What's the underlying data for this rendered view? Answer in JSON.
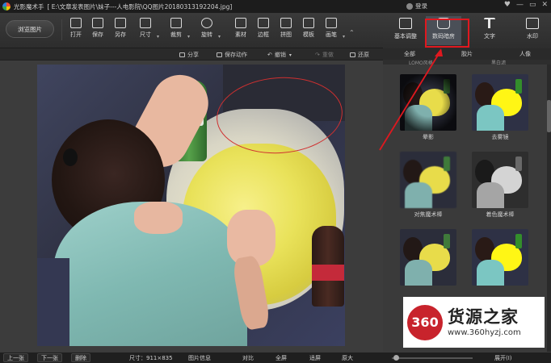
{
  "window": {
    "app_name": "光影魔术手",
    "file_path": "[ E:\\文章发表图片\\妹子---人电影院\\QQ图片20180313192204.jpg]",
    "login_label": "登录",
    "controls": [
      "♥",
      "—",
      "▭",
      "✕"
    ]
  },
  "toolbar": {
    "browse_label": "浏览图片",
    "tools": [
      {
        "label": "打开",
        "icon": "open-icon"
      },
      {
        "label": "保存",
        "icon": "save-icon"
      },
      {
        "label": "另存",
        "icon": "save-as-icon"
      },
      {
        "label": "尺寸",
        "icon": "resize-icon"
      },
      {
        "label": "裁剪",
        "icon": "crop-icon"
      },
      {
        "label": "旋转",
        "icon": "rotate-icon"
      },
      {
        "label": "素材",
        "icon": "material-icon"
      },
      {
        "label": "边框",
        "icon": "border-icon"
      },
      {
        "label": "拼图",
        "icon": "collage-icon"
      },
      {
        "label": "模板",
        "icon": "template-icon"
      },
      {
        "label": "画笔",
        "icon": "brush-icon"
      }
    ],
    "more_icon": "ellipsis-icon"
  },
  "right_tabs": [
    {
      "label": "基本调整",
      "icon": "adjust-icon"
    },
    {
      "label": "数码暗房",
      "icon": "camera-icon",
      "active": true
    },
    {
      "label": "文字",
      "icon": "text-icon"
    },
    {
      "label": "水印",
      "icon": "watermark-icon"
    }
  ],
  "actions": {
    "share": "分享",
    "save_action": "保存动作",
    "undo": "撤销",
    "redo": "重做",
    "restore": "还原"
  },
  "subtabs": {
    "all": "全部",
    "film": "胶片",
    "portrait": "人像",
    "hint_left": "LOMO风格",
    "hint_right": "黑白滤"
  },
  "effects": [
    {
      "label": "晕影"
    },
    {
      "label": "去雾镜"
    },
    {
      "label": "对焦魔术棒"
    },
    {
      "label": "着色魔术棒"
    },
    {
      "label": ""
    },
    {
      "label": ""
    }
  ],
  "watermark": {
    "badge": "360",
    "brand": "货源之家",
    "url": "www.360hyzj.com"
  },
  "status": {
    "prev": "上一张",
    "next": "下一张",
    "delete": "删除",
    "size": "尺寸：911×835",
    "info": "图片信息",
    "compare": "对比",
    "fullscreen": "全屏",
    "fit": "适屏",
    "zoom_in": "原大",
    "expand": "展开(I)"
  },
  "colors": {
    "annotation_red": "#e0181f",
    "panel_bg": "#3a3a3a",
    "toolbar_bg": "#333333"
  }
}
